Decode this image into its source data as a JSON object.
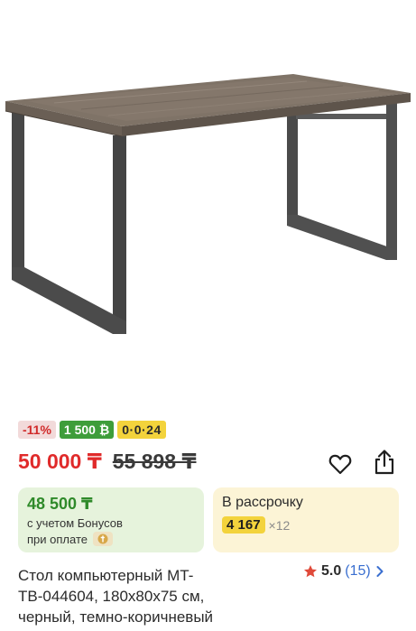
{
  "product": {
    "image_alt": "Стол компьютерный",
    "badges": {
      "discount": "-11%",
      "bonus": "1 500 ₿",
      "installment": "0·0·24"
    },
    "price": {
      "current": "50 000 ₸",
      "old": "55 898 ₸"
    },
    "bonus_card": {
      "price": "48 500 ₸",
      "line1": "с учетом Бонусов",
      "line2": "при оплате"
    },
    "credit_card": {
      "title": "В рассрочку",
      "amount": "4 167",
      "multiplier": "×12"
    },
    "title_lines": [
      "Стол компьютерный MT-",
      "TB-044604, 180x80x75 см,",
      "черный, темно-коричневый"
    ],
    "rating": {
      "value": "5.0",
      "count": "(15)"
    }
  },
  "icons": {
    "favorite": "heart-icon",
    "share": "share-icon",
    "star": "star-icon",
    "chevron": "chevron-right-icon",
    "coin": "coin-icon"
  },
  "colors": {
    "price": "#e02a2a",
    "bonus_green": "#3e9d3a",
    "installment_yellow": "#f3d33c",
    "star_red": "#e04a3a",
    "link_blue": "#3a6fd0"
  }
}
